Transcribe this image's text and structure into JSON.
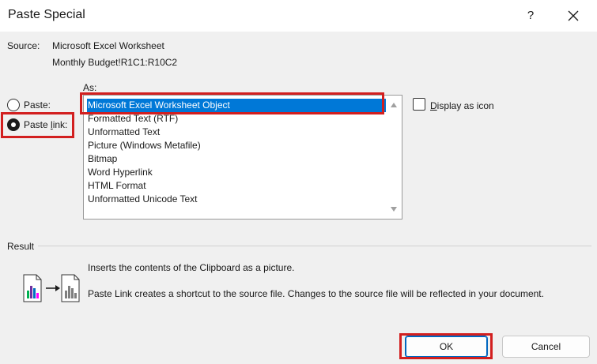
{
  "window": {
    "title": "Paste Special",
    "help_label": "?"
  },
  "source": {
    "label": "Source:",
    "name": "Microsoft Excel Worksheet",
    "range": "Monthly Budget!R1C1:R10C2"
  },
  "as_label": "As:",
  "paste_options": {
    "paste_label": "Paste:",
    "paste_link_label": "Paste link:",
    "selected": "paste_link"
  },
  "formats": {
    "items": [
      "Microsoft Excel Worksheet Object",
      "Formatted Text (RTF)",
      "Unformatted Text",
      "Picture (Windows Metafile)",
      "Bitmap",
      "Word Hyperlink",
      "HTML Format",
      "Unformatted Unicode Text"
    ],
    "selected_index": 0
  },
  "display_as_icon": {
    "label": "Display as icon",
    "checked": false
  },
  "result": {
    "label": "Result",
    "line1": "Inserts the contents of the Clipboard as a picture.",
    "line2": "Paste Link creates a shortcut to the source file. Changes to the source file will be reflected in your document."
  },
  "buttons": {
    "ok": "OK",
    "cancel": "Cancel"
  },
  "colors": {
    "highlight": "#d21f1f",
    "selection": "#0078d7"
  }
}
